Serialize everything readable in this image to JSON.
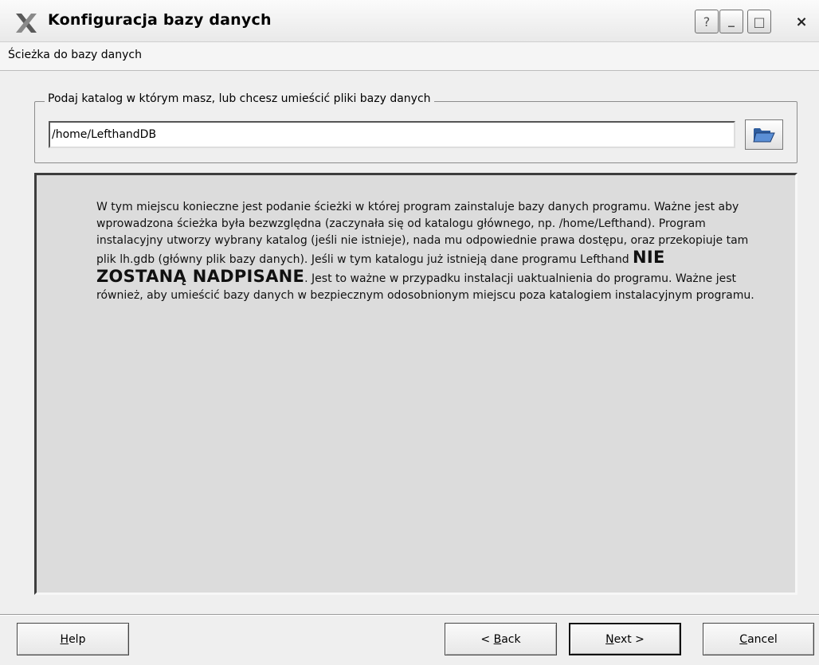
{
  "window": {
    "title": "Konfiguracja bazy danych",
    "help_glyph": "?",
    "min_glyph": "_",
    "max_glyph": "□",
    "close_glyph": "×",
    "icon": "x-logo-icon"
  },
  "page_header": "Ścieżka do bazy danych",
  "group": {
    "legend": "Podaj katalog w którym masz, lub chcesz umieścić pliki bazy danych",
    "path_value": "/home/LefthandDB",
    "browse_icon": "open-folder-icon"
  },
  "info": {
    "text_before": "W tym miejscu konieczne jest podanie ścieżki w której program zainstaluje bazy danych programu. Ważne jest aby wprowadzona ścieżka była bezwzględna (zaczynała się od katalogu głównego, np. /home/Lefthand). Program instalacyjny utworzy wybrany katalog (jeśli nie istnieje), nada mu odpowiednie prawa dostępu, oraz przekopiuje tam plik lh.gdb (główny plik bazy danych). Jeśli w tym katalogu już istnieją dane programu Lefthand ",
    "emphasis": "NIE ZOSTANĄ NADPISANE",
    "text_after": ". Jest to ważne w przypadku instalacji uaktualnienia do programu. Ważne jest również, aby umieścić bazy danych w bezpiecznym odosobnionym miejscu poza katalogiem instalacyjnym programu."
  },
  "buttons": {
    "help": {
      "mnemonic": "H",
      "rest": "elp"
    },
    "back": {
      "prefix": "< ",
      "mnemonic": "B",
      "rest": "ack"
    },
    "next": {
      "mnemonic": "N",
      "rest": "ext >"
    },
    "cancel": {
      "mnemonic": "C",
      "rest": "ancel"
    }
  }
}
